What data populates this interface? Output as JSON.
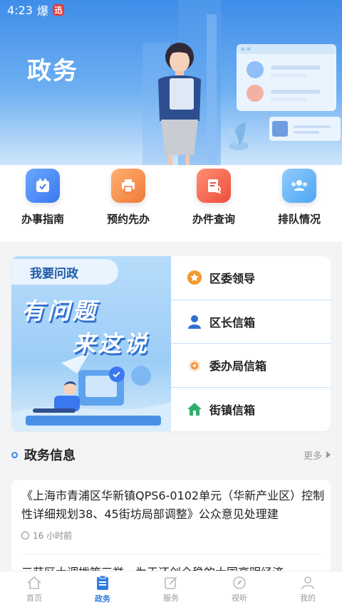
{
  "status_bar": {
    "time": "4:23",
    "indicator": "爆",
    "badge": "迅"
  },
  "hero": {
    "title": "政务"
  },
  "quick_actions": [
    {
      "label": "办事指南",
      "icon": "calendar-check-icon",
      "color": "#3a78ef"
    },
    {
      "label": "预约先办",
      "icon": "printer-icon",
      "color": "#f07a3a"
    },
    {
      "label": "办件查询",
      "icon": "document-search-icon",
      "color": "#ee4d3a"
    },
    {
      "label": "排队情况",
      "icon": "people-queue-icon",
      "color": "#4ea6f3"
    }
  ],
  "ask": {
    "tag": "我要问政",
    "headline_1": "有问题",
    "headline_2": "来这说",
    "items": [
      {
        "label": "区委领导",
        "icon": "star-badge-icon"
      },
      {
        "label": "区长信箱",
        "icon": "person-icon"
      },
      {
        "label": "委办局信箱",
        "icon": "medal-icon"
      },
      {
        "label": "街镇信箱",
        "icon": "house-icon"
      }
    ]
  },
  "news": {
    "title": "政务信息",
    "more": "更多",
    "items": [
      {
        "text": "《上海市青浦区华新镇QPS6-0102单元（华新产业区）控制性详细规划38、45街坊局部调整》公众意见处理建",
        "time": "16 小时前"
      },
      {
        "text": "三获区大调拨等三举，为于还创全稳的大国高明经济"
      }
    ]
  },
  "tabbar": [
    {
      "label": "首页",
      "icon": "home-icon",
      "active": false
    },
    {
      "label": "政务",
      "icon": "clipboard-icon",
      "active": true
    },
    {
      "label": "服务",
      "icon": "edit-icon",
      "active": false
    },
    {
      "label": "视听",
      "icon": "compass-icon",
      "active": false
    },
    {
      "label": "我的",
      "icon": "user-icon",
      "active": false
    }
  ],
  "colors": {
    "brand": "#2f7be6",
    "hero_top": "#3f8de9"
  }
}
